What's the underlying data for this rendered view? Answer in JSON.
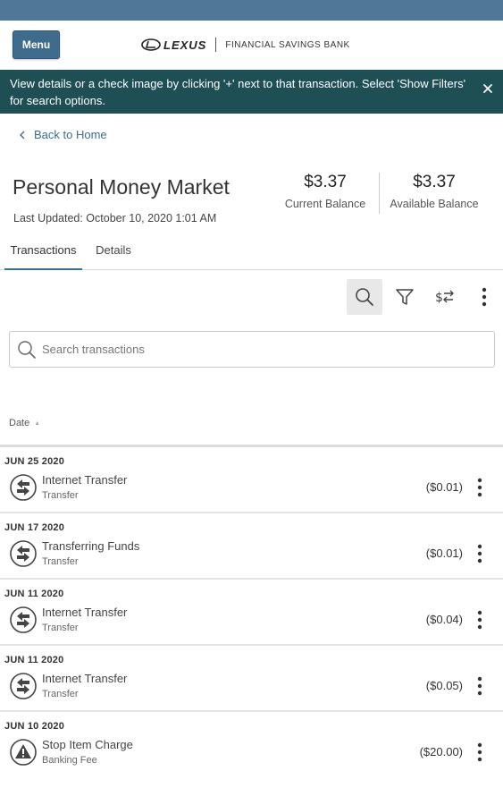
{
  "header": {
    "menu_label": "Menu",
    "brand_logo": "LEXUS",
    "brand_bank": "FINANCIAL SAVINGS BANK"
  },
  "banner": {
    "message": "View details or a check image by clicking '+' next to that transaction. Select 'Show Filters' for search options.",
    "close_icon": "close-icon"
  },
  "nav": {
    "back_label": "Back to Home"
  },
  "account": {
    "title": "Personal Money Market",
    "last_updated": "Last Updated: October 10, 2020 1:01 AM",
    "current_balance": "$3.37",
    "current_balance_label": "Current Balance",
    "available_balance": "$3.37",
    "available_balance_label": "Available Balance"
  },
  "tabs": {
    "transactions": "Transactions",
    "details": "Details",
    "active": "Transactions"
  },
  "toolbar": {
    "icons": [
      "search-icon",
      "filter-icon",
      "dollar-exchange-icon",
      "more-vertical-icon"
    ]
  },
  "search": {
    "placeholder": "Search transactions",
    "value": ""
  },
  "list": {
    "date_header": "Date",
    "sort_indicator": "▲"
  },
  "transactions": [
    {
      "date": "JUN 25 2020",
      "name": "Internet Transfer",
      "type": "Transfer",
      "amount": "($0.01)",
      "icon": "transfer-icon"
    },
    {
      "date": "JUN 17 2020",
      "name": "Transferring Funds",
      "type": "Transfer",
      "amount": "($0.01)",
      "icon": "transfer-icon"
    },
    {
      "date": "JUN 11 2020",
      "name": "Internet Transfer",
      "type": "Transfer",
      "amount": "($0.04)",
      "icon": "transfer-icon"
    },
    {
      "date": "JUN 11 2020",
      "name": "Internet Transfer",
      "type": "Transfer",
      "amount": "($0.05)",
      "icon": "transfer-icon"
    },
    {
      "date": "JUN 10 2020",
      "name": "Stop Item Charge",
      "type": "Banking Fee",
      "amount": "($20.00)",
      "icon": "warning-icon"
    }
  ],
  "colors": {
    "topbar": "#4f7896",
    "menu_button": "#3f6c8d",
    "banner": "#1e4f55",
    "link": "#3c6e8f"
  }
}
